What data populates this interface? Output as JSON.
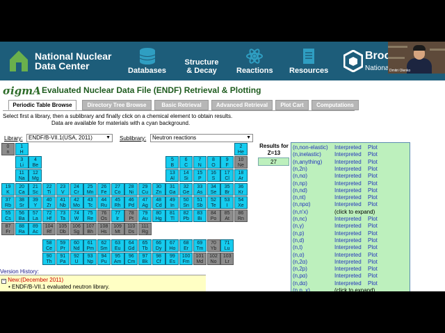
{
  "header": {
    "org_line1": "National Nuclear",
    "org_line2": "Data Center",
    "nav": [
      {
        "label": "Databases",
        "icon": "database-icon"
      },
      {
        "label": "Structure\n& Decay",
        "icon": "structure-icon"
      },
      {
        "label": "Reactions",
        "icon": "atom-icon"
      },
      {
        "label": "Resources",
        "icon": "document-icon"
      }
    ],
    "partner": "Broo",
    "partner_sub": "Nationa",
    "colors": {
      "bar": "#1d5d7a",
      "accent": "#2f9ec2"
    }
  },
  "page": {
    "logo_text": "σigmA",
    "title": "Evaluated Nuclear Data File (ENDF) Retrieval & Plotting",
    "tabs": [
      "Periodic Table Browse",
      "Directory Tree Browse",
      "Basic Retrieval",
      "Advanced Retrieval",
      "Plot Cart",
      "Computations"
    ],
    "instruction1": "Select first a library, then a sublibrary and finally click on a chemical element to obtain results.",
    "instruction2": "Data are available for materials with a cyan background.",
    "library_label": "Library:",
    "library_value": "ENDF/B-VII.1(USA, 2011)",
    "sublibrary_label": "Sublibrary:",
    "sublibrary_value": "Neutron reactions",
    "results_label": "Results for Z=13",
    "results_count": "27"
  },
  "elements": [
    {
      "z": "0",
      "s": "n",
      "g": 1
    },
    {
      "z": "1",
      "s": "H",
      "g": 0
    },
    {
      "z": "2",
      "s": "He",
      "g": 0
    },
    {
      "z": "3",
      "s": "Li",
      "g": 0
    },
    {
      "z": "4",
      "s": "Be",
      "g": 0
    },
    {
      "z": "5",
      "s": "B",
      "g": 0
    },
    {
      "z": "6",
      "s": "C",
      "g": 0
    },
    {
      "z": "7",
      "s": "N",
      "g": 0
    },
    {
      "z": "8",
      "s": "O",
      "g": 0
    },
    {
      "z": "9",
      "s": "F",
      "g": 0
    },
    {
      "z": "10",
      "s": "Ne",
      "g": 1
    },
    {
      "z": "11",
      "s": "Na",
      "g": 0
    },
    {
      "z": "12",
      "s": "Mg",
      "g": 0
    },
    {
      "z": "13",
      "s": "Al",
      "g": 0
    },
    {
      "z": "14",
      "s": "Si",
      "g": 0
    },
    {
      "z": "15",
      "s": "P",
      "g": 0
    },
    {
      "z": "16",
      "s": "S",
      "g": 0
    },
    {
      "z": "17",
      "s": "Cl",
      "g": 0
    },
    {
      "z": "18",
      "s": "Ar",
      "g": 0
    },
    {
      "z": "19",
      "s": "K",
      "g": 0
    },
    {
      "z": "20",
      "s": "Ca",
      "g": 0
    },
    {
      "z": "21",
      "s": "Sc",
      "g": 0
    },
    {
      "z": "22",
      "s": "Ti",
      "g": 0
    },
    {
      "z": "23",
      "s": "V",
      "g": 0
    },
    {
      "z": "24",
      "s": "Cr",
      "g": 0
    },
    {
      "z": "25",
      "s": "Mn",
      "g": 0
    },
    {
      "z": "26",
      "s": "Fe",
      "g": 0
    },
    {
      "z": "27",
      "s": "Co",
      "g": 0
    },
    {
      "z": "28",
      "s": "Ni",
      "g": 0
    },
    {
      "z": "29",
      "s": "Cu",
      "g": 0
    },
    {
      "z": "30",
      "s": "Zn",
      "g": 0
    },
    {
      "z": "31",
      "s": "Ga",
      "g": 0
    },
    {
      "z": "32",
      "s": "Ge",
      "g": 0
    },
    {
      "z": "33",
      "s": "As",
      "g": 0
    },
    {
      "z": "34",
      "s": "Se",
      "g": 0
    },
    {
      "z": "35",
      "s": "Br",
      "g": 0
    },
    {
      "z": "36",
      "s": "Kr",
      "g": 0
    },
    {
      "z": "37",
      "s": "Rb",
      "g": 0
    },
    {
      "z": "38",
      "s": "Sr",
      "g": 0
    },
    {
      "z": "39",
      "s": "Y",
      "g": 0
    },
    {
      "z": "40",
      "s": "Zr",
      "g": 0
    },
    {
      "z": "41",
      "s": "Nb",
      "g": 0
    },
    {
      "z": "42",
      "s": "Mo",
      "g": 0
    },
    {
      "z": "43",
      "s": "Tc",
      "g": 0
    },
    {
      "z": "44",
      "s": "Ru",
      "g": 0
    },
    {
      "z": "45",
      "s": "Rh",
      "g": 0
    },
    {
      "z": "46",
      "s": "Pd",
      "g": 0
    },
    {
      "z": "47",
      "s": "Ag",
      "g": 0
    },
    {
      "z": "48",
      "s": "Cd",
      "g": 0
    },
    {
      "z": "49",
      "s": "In",
      "g": 0
    },
    {
      "z": "50",
      "s": "Sn",
      "g": 0
    },
    {
      "z": "51",
      "s": "Sb",
      "g": 0
    },
    {
      "z": "52",
      "s": "Te",
      "g": 0
    },
    {
      "z": "53",
      "s": "I",
      "g": 0
    },
    {
      "z": "54",
      "s": "Xe",
      "g": 0
    },
    {
      "z": "55",
      "s": "Cs",
      "g": 0
    },
    {
      "z": "56",
      "s": "Ba",
      "g": 0
    },
    {
      "z": "57",
      "s": "La",
      "g": 0
    },
    {
      "z": "72",
      "s": "Hf",
      "g": 0
    },
    {
      "z": "73",
      "s": "Ta",
      "g": 0
    },
    {
      "z": "74",
      "s": "W",
      "g": 0
    },
    {
      "z": "75",
      "s": "Re",
      "g": 0
    },
    {
      "z": "76",
      "s": "Os",
      "g": 1
    },
    {
      "z": "77",
      "s": "Ir",
      "g": 0
    },
    {
      "z": "78",
      "s": "Pt",
      "g": 1
    },
    {
      "z": "79",
      "s": "Au",
      "g": 0
    },
    {
      "z": "80",
      "s": "Hg",
      "g": 0
    },
    {
      "z": "81",
      "s": "Tl",
      "g": 0
    },
    {
      "z": "82",
      "s": "Pb",
      "g": 0
    },
    {
      "z": "83",
      "s": "Bi",
      "g": 0
    },
    {
      "z": "84",
      "s": "Po",
      "g": 1
    },
    {
      "z": "85",
      "s": "At",
      "g": 1
    },
    {
      "z": "86",
      "s": "Rn",
      "g": 1
    },
    {
      "z": "87",
      "s": "Fr",
      "g": 1
    },
    {
      "z": "88",
      "s": "Ra",
      "g": 0
    },
    {
      "z": "89",
      "s": "Ac",
      "g": 0
    },
    {
      "z": "104",
      "s": "Rf",
      "g": 1
    },
    {
      "z": "105",
      "s": "Db",
      "g": 1
    },
    {
      "z": "106",
      "s": "Sg",
      "g": 1
    },
    {
      "z": "107",
      "s": "Bh",
      "g": 1
    },
    {
      "z": "108",
      "s": "Hs",
      "g": 1
    },
    {
      "z": "109",
      "s": "Mt",
      "g": 1
    },
    {
      "z": "110",
      "s": "Ds",
      "g": 1
    },
    {
      "z": "111",
      "s": "Rg",
      "g": 1
    },
    {
      "z": "58",
      "s": "Ce",
      "g": 0
    },
    {
      "z": "59",
      "s": "Pr",
      "g": 0
    },
    {
      "z": "60",
      "s": "Nd",
      "g": 0
    },
    {
      "z": "61",
      "s": "Pm",
      "g": 0
    },
    {
      "z": "62",
      "s": "Sm",
      "g": 0
    },
    {
      "z": "63",
      "s": "Eu",
      "g": 0
    },
    {
      "z": "64",
      "s": "Gd",
      "g": 0
    },
    {
      "z": "65",
      "s": "Tb",
      "g": 0
    },
    {
      "z": "66",
      "s": "Dy",
      "g": 0
    },
    {
      "z": "67",
      "s": "Ho",
      "g": 0
    },
    {
      "z": "68",
      "s": "Er",
      "g": 0
    },
    {
      "z": "69",
      "s": "Tm",
      "g": 0
    },
    {
      "z": "70",
      "s": "Yb",
      "g": 1
    },
    {
      "z": "71",
      "s": "Lu",
      "g": 0
    },
    {
      "z": "90",
      "s": "Th",
      "g": 0
    },
    {
      "z": "91",
      "s": "Pa",
      "g": 0
    },
    {
      "z": "92",
      "s": "U",
      "g": 0
    },
    {
      "z": "93",
      "s": "Np",
      "g": 0
    },
    {
      "z": "94",
      "s": "Pu",
      "g": 0
    },
    {
      "z": "95",
      "s": "Am",
      "g": 0
    },
    {
      "z": "96",
      "s": "Cm",
      "g": 0
    },
    {
      "z": "97",
      "s": "Bk",
      "g": 0
    },
    {
      "z": "98",
      "s": "Cf",
      "g": 0
    },
    {
      "z": "99",
      "s": "Es",
      "g": 0
    },
    {
      "z": "100",
      "s": "Fm",
      "g": 0
    },
    {
      "z": "101",
      "s": "Md",
      "g": 1
    },
    {
      "z": "102",
      "s": "No",
      "g": 1
    },
    {
      "z": "103",
      "s": "Lr",
      "g": 1
    }
  ],
  "reactions": [
    {
      "name": "(n,non-elastic)",
      "a1": "Interpreted",
      "a2": "Plot"
    },
    {
      "name": "(n,inelastic)",
      "a1": "Interpreted",
      "a2": "Plot"
    },
    {
      "name": "(n,anything)",
      "a1": "Interpreted",
      "a2": "Plot"
    },
    {
      "name": "(n,2n)",
      "a1": "Interpreted",
      "a2": "Plot"
    },
    {
      "name": "(n,nα)",
      "a1": "Interpreted",
      "a2": "Plot"
    },
    {
      "name": "(n,np)",
      "a1": "Interpreted",
      "a2": "Plot"
    },
    {
      "name": "(n,nd)",
      "a1": "Interpreted",
      "a2": "Plot"
    },
    {
      "name": "(n,nt)",
      "a1": "Interpreted",
      "a2": "Plot"
    },
    {
      "name": "(n,npα)",
      "a1": "Interpreted",
      "a2": "Plot"
    },
    {
      "name": "(n,n'x)",
      "a1": "",
      "a2": "",
      "expand": "(click to expand)"
    },
    {
      "name": "(n,nc)",
      "a1": "Interpreted",
      "a2": "Plot"
    },
    {
      "name": "(n,γ)",
      "a1": "Interpreted",
      "a2": "Plot"
    },
    {
      "name": "(n,p)",
      "a1": "Interpreted",
      "a2": "Plot"
    },
    {
      "name": "(n,d)",
      "a1": "Interpreted",
      "a2": "Plot"
    },
    {
      "name": "(n,t)",
      "a1": "Interpreted",
      "a2": "Plot"
    },
    {
      "name": "(n,α)",
      "a1": "Interpreted",
      "a2": "Plot"
    },
    {
      "name": "(n,2α)",
      "a1": "Interpreted",
      "a2": "Plot"
    },
    {
      "name": "(n,2p)",
      "a1": "Interpreted",
      "a2": "Plot"
    },
    {
      "name": "(n,pα)",
      "a1": "Interpreted",
      "a2": "Plot"
    },
    {
      "name": "(n,dα)",
      "a1": "Interpreted",
      "a2": "Plot"
    },
    {
      "name": "(n,p_x)",
      "a1": "",
      "a2": "",
      "expand": "(click to expand)"
    }
  ],
  "version_history": {
    "title": "Version History:",
    "new_label": "New:(December 2011)",
    "item": "• ENDF/B-VII.1 evaluated neutron library."
  },
  "webcam": {
    "name": "Dmitri Olenko"
  }
}
